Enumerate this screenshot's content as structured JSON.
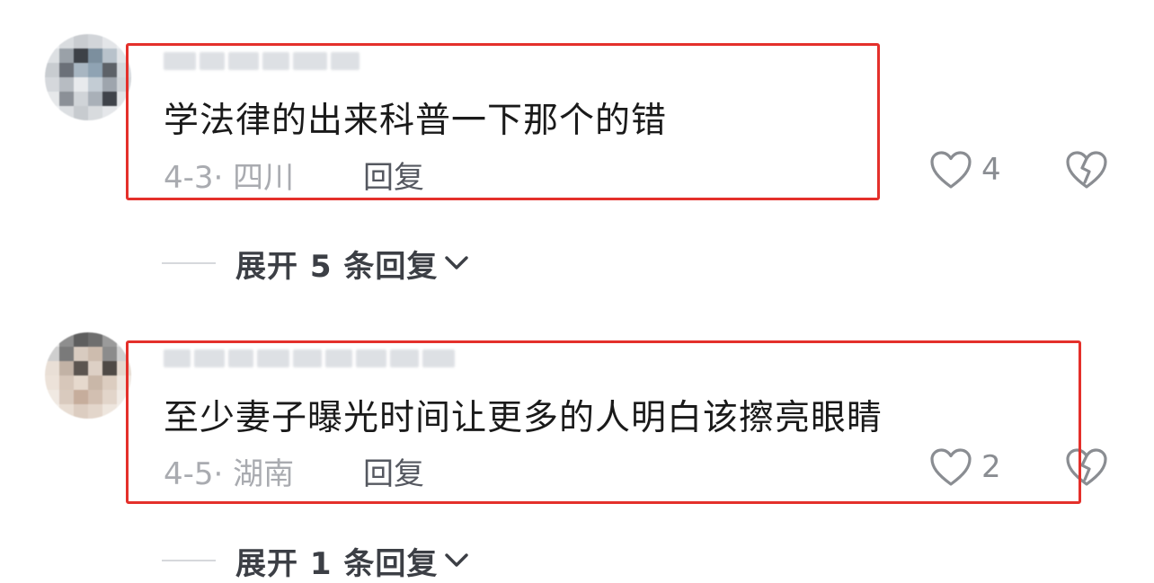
{
  "comments": [
    {
      "text": "学法律的出来科普一下那个的错",
      "date": "4-3",
      "separator": "·",
      "location": "四川",
      "reply_label": "回复",
      "likes": "4",
      "expand_label": "展开 5 条回复"
    },
    {
      "text": "至少妻子曝光时间让更多的人明白该擦亮眼睛",
      "date": "4-5",
      "separator": "·",
      "location": "湖南",
      "reply_label": "回复",
      "likes": "2",
      "expand_label": "展开 1 条回复"
    }
  ],
  "colors": {
    "highlight": "#e4302b",
    "meta_text": "#a9abb0",
    "body_text": "#1a1a1a"
  },
  "icons": [
    "heart-outline-icon",
    "broken-heart-icon",
    "chevron-down-icon"
  ]
}
